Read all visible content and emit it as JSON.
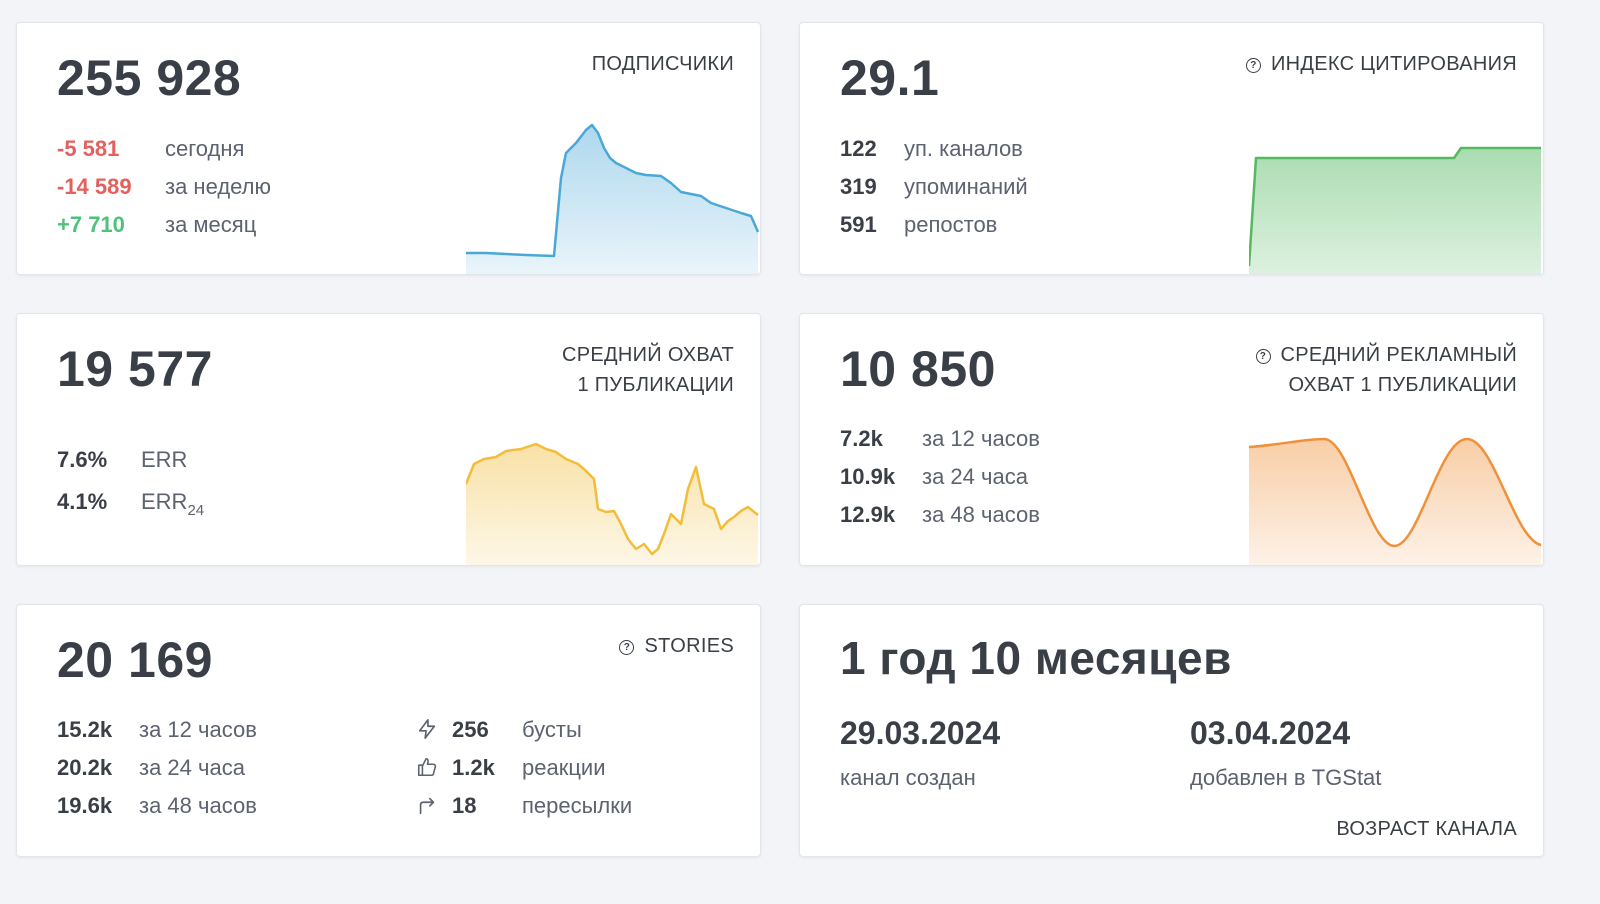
{
  "subscribers": {
    "value": "255 928",
    "title": "ПОДПИСЧИКИ",
    "rows": [
      {
        "num": "-5 581",
        "label": "сегодня"
      },
      {
        "num": "-14 589",
        "label": "за неделю"
      },
      {
        "num": "+7 710",
        "label": "за месяц"
      }
    ],
    "color": "#4aa8d8"
  },
  "citation": {
    "value": "29.1",
    "title": "ИНДЕКС ЦИТИРОВАНИЯ",
    "rows": [
      {
        "num": "122",
        "label": "уп. каналов"
      },
      {
        "num": "319",
        "label": "упоминаний"
      },
      {
        "num": "591",
        "label": "репостов"
      }
    ],
    "color": "#55b961"
  },
  "reach": {
    "value": "19 577",
    "title_line1": "СРЕДНИЙ ОХВАТ",
    "title_line2": "1 ПУБЛИКАЦИИ",
    "rows": [
      {
        "num": "7.6%",
        "label": "ERR",
        "sub": ""
      },
      {
        "num": "4.1%",
        "label": "ERR",
        "sub": "24"
      }
    ],
    "color": "#f2bd3a"
  },
  "ad_reach": {
    "value": "10 850",
    "title_line1": "СРЕДНИЙ РЕКЛАМНЫЙ",
    "title_line2": "ОХВАТ 1 ПУБЛИКАЦИИ",
    "rows": [
      {
        "num": "7.2k",
        "label": "за 12 часов"
      },
      {
        "num": "10.9k",
        "label": "за 24 часа"
      },
      {
        "num": "12.9k",
        "label": "за 48 часов"
      }
    ],
    "color": "#f0913a"
  },
  "stories": {
    "value": "20 169",
    "title": "STORIES",
    "rows": [
      {
        "num": "15.2k",
        "label": "за 12 часов"
      },
      {
        "num": "20.2k",
        "label": "за 24 часа"
      },
      {
        "num": "19.6k",
        "label": "за 48 часов"
      }
    ],
    "stats": [
      {
        "icon": "lightning-icon",
        "num": "256",
        "label": "бусты"
      },
      {
        "icon": "thumbs-up-icon",
        "num": "1.2k",
        "label": "реакции"
      },
      {
        "icon": "forward-arrow-icon",
        "num": "18",
        "label": "пересылки"
      }
    ]
  },
  "age": {
    "value": "1 год 10 месяцев",
    "created_date": "29.03.2024",
    "created_label": "канал создан",
    "added_date": "03.04.2024",
    "added_label": "добавлен в TGStat",
    "title": "ВОЗРАСТ КАНАЛА"
  }
}
